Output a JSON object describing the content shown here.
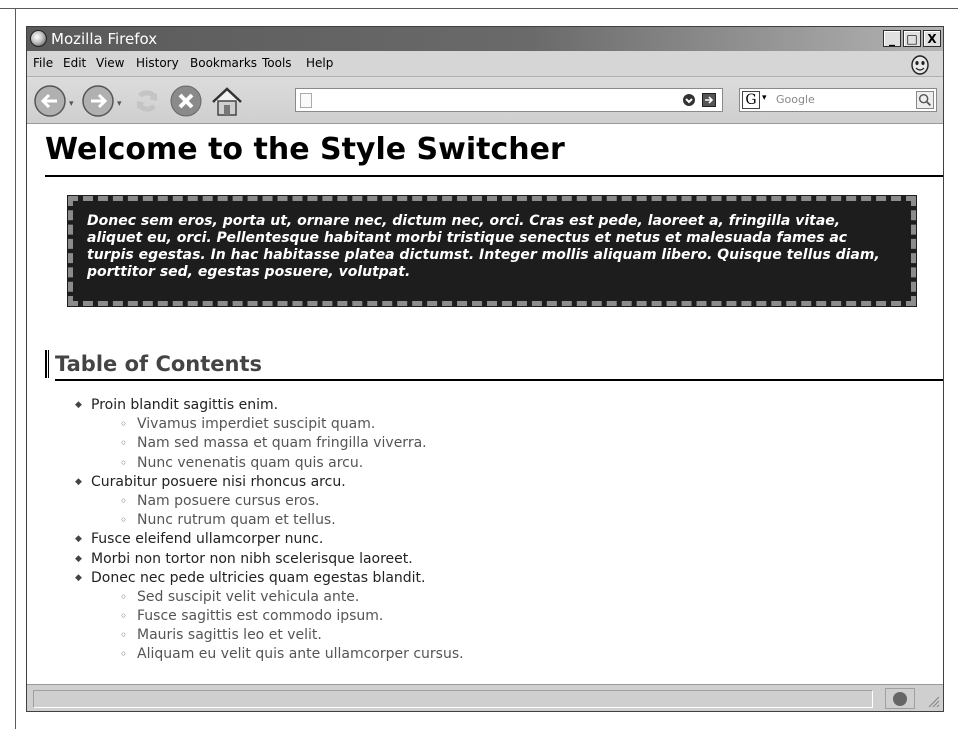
{
  "window": {
    "title": "Mozilla Firefox",
    "controls": {
      "minimize": "_",
      "maximize": "□",
      "close": "X"
    }
  },
  "menu": {
    "items": [
      "File",
      "Edit",
      "View",
      "History",
      "Bookmarks",
      "Tools",
      "Help"
    ]
  },
  "navbar": {
    "url_value": "",
    "search_engine": "G",
    "search_placeholder": "Google"
  },
  "page": {
    "heading": "Welcome to the Style Switcher",
    "quote": "Donec sem eros, porta ut, ornare nec, dictum nec, orci. Cras est pede, laoreet a, fringilla vitae, aliquet eu, orci. Pellentesque habitant morbi tristique senectus et netus et malesuada fames ac turpis egestas. In hac habitasse platea dictumst. Integer mollis aliquam libero. Quisque tellus diam, porttitor sed, egestas posuere, volutpat.",
    "toc_heading": "Table of Contents",
    "toc": [
      {
        "level": 1,
        "text": "Proin blandit sagittis enim."
      },
      {
        "level": 2,
        "text": "Vivamus imperdiet suscipit quam."
      },
      {
        "level": 2,
        "text": "Nam sed massa et quam fringilla viverra."
      },
      {
        "level": 2,
        "text": "Nunc venenatis quam quis arcu."
      },
      {
        "level": 1,
        "text": "Curabitur posuere nisi rhoncus arcu."
      },
      {
        "level": 2,
        "text": "Nam posuere cursus eros."
      },
      {
        "level": 2,
        "text": "Nunc rutrum quam et tellus."
      },
      {
        "level": 1,
        "text": "Fusce eleifend ullamcorper nunc."
      },
      {
        "level": 1,
        "text": "Morbi non tortor non nibh scelerisque laoreet."
      },
      {
        "level": 1,
        "text": "Donec nec pede ultricies quam egestas blandit."
      },
      {
        "level": 2,
        "text": "Sed suscipit velit vehicula ante."
      },
      {
        "level": 2,
        "text": "Fusce sagittis est commodo ipsum."
      },
      {
        "level": 2,
        "text": "Mauris sagittis leo et velit."
      },
      {
        "level": 2,
        "text": "Aliquam eu velit quis ante ullamcorper cursus."
      }
    ]
  },
  "status": {
    "text": ""
  }
}
